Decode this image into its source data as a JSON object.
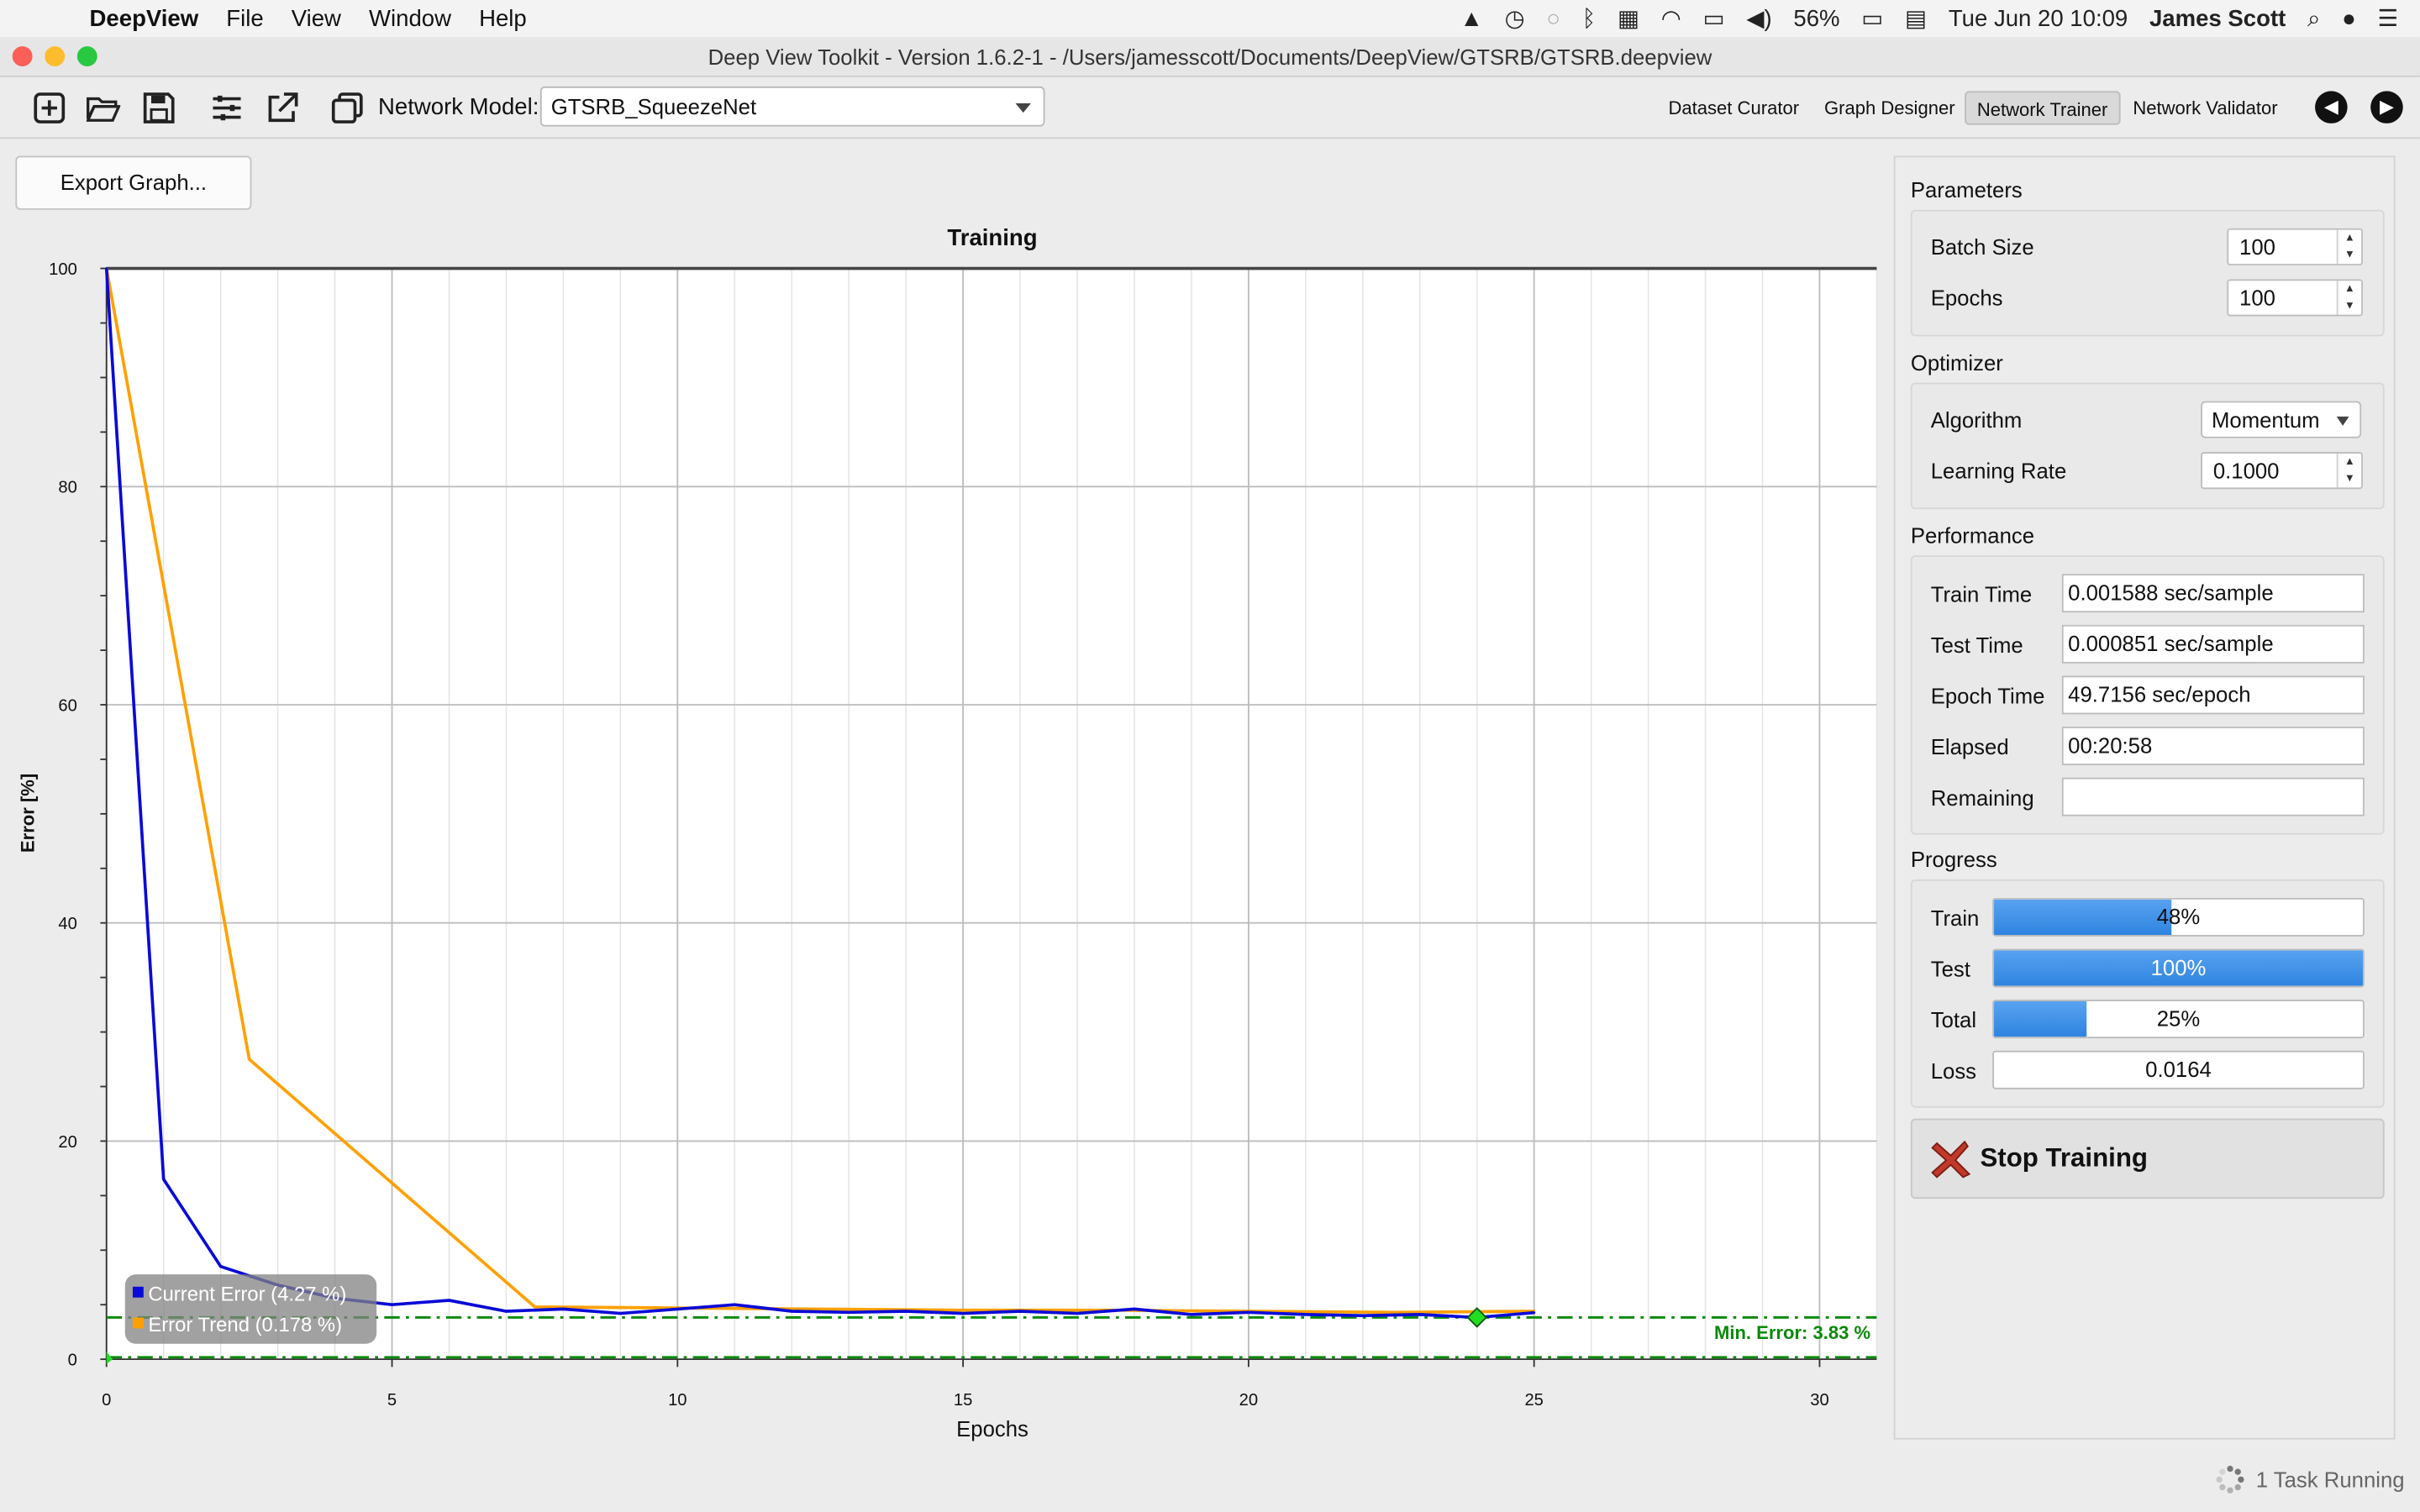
{
  "menubar": {
    "app_name": "DeepView",
    "menus": [
      "File",
      "View",
      "Window",
      "Help"
    ],
    "battery": "56%",
    "datetime": "Tue Jun 20  10:09",
    "user": "James Scott"
  },
  "window": {
    "title": "Deep View Toolkit  -  Version 1.6.2-1 - /Users/jamesscott/Documents/DeepView/GTSRB/GTSRB.deepview"
  },
  "toolbar": {
    "network_model_label": "Network Model:",
    "network_model_value": "GTSRB_SqueezeNet",
    "views": [
      "Dataset Curator",
      "Graph Designer",
      "Network Trainer",
      "Network Validator"
    ],
    "active_view": "Network Trainer"
  },
  "left": {
    "export_button": "Export Graph..."
  },
  "chart_data": {
    "type": "line",
    "title": "Training",
    "xlabel": "Epochs",
    "ylabel": "Error [%]",
    "xlim": [
      0,
      31
    ],
    "ylim": [
      0,
      100
    ],
    "xticks": [
      0,
      5,
      10,
      15,
      20,
      25,
      30
    ],
    "yticks": [
      0,
      20,
      40,
      60,
      80,
      100
    ],
    "grid": true,
    "legend_position": "bottom-left",
    "series": [
      {
        "name": "Current Error (4.27 %)",
        "color": "#0a0ad8",
        "x": [
          0,
          1,
          2,
          3,
          4,
          5,
          6,
          7,
          8,
          9,
          10,
          11,
          12,
          13,
          14,
          15,
          16,
          17,
          18,
          19,
          20,
          21,
          22,
          23,
          24,
          25
        ],
        "y": [
          100,
          16.5,
          8.5,
          6.8,
          5.6,
          5.0,
          5.4,
          4.4,
          4.6,
          4.2,
          4.6,
          5.0,
          4.4,
          4.3,
          4.4,
          4.2,
          4.4,
          4.2,
          4.6,
          4.1,
          4.3,
          4.1,
          4.0,
          4.1,
          3.83,
          4.27
        ]
      },
      {
        "name": "Error Trend (0.178 %)",
        "color": "#ffa000",
        "x": [
          0,
          2.5,
          7.5,
          10,
          12.5,
          15,
          17.5,
          20,
          22.5,
          25
        ],
        "y": [
          100,
          27.5,
          4.8,
          4.7,
          4.6,
          4.5,
          4.5,
          4.4,
          4.3,
          4.4
        ]
      }
    ],
    "reference_lines": [
      {
        "label": "Min. Error: 3.83 %",
        "y": 3.83,
        "color": "#0a8a0a"
      },
      {
        "label": "",
        "y": 0.178,
        "color": "#0a8a0a"
      }
    ],
    "min_marker": {
      "x": 24,
      "y": 3.83
    }
  },
  "parameters": {
    "title": "Parameters",
    "batch_size_label": "Batch Size",
    "batch_size": "100",
    "epochs_label": "Epochs",
    "epochs": "100"
  },
  "optimizer": {
    "title": "Optimizer",
    "algorithm_label": "Algorithm",
    "algorithm": "Momentum",
    "learning_rate_label": "Learning Rate",
    "learning_rate": "0.1000"
  },
  "performance": {
    "title": "Performance",
    "train_time_label": "Train Time",
    "train_time": "0.001588 sec/sample",
    "test_time_label": "Test Time",
    "test_time": "0.000851 sec/sample",
    "epoch_time_label": "Epoch Time",
    "epoch_time": "49.7156 sec/epoch",
    "elapsed_label": "Elapsed",
    "elapsed": "00:20:58",
    "remaining_label": "Remaining",
    "remaining": ""
  },
  "progress": {
    "title": "Progress",
    "train_label": "Train",
    "train_text": "48%",
    "train_value": 0.48,
    "test_label": "Test",
    "test_text": "100%",
    "test_value": 1.0,
    "total_label": "Total",
    "total_text": "25%",
    "total_value": 0.25,
    "loss_label": "Loss",
    "loss": "0.0164"
  },
  "actions": {
    "stop_training": "Stop Training"
  },
  "status": {
    "tasks": "1 Task Running"
  }
}
